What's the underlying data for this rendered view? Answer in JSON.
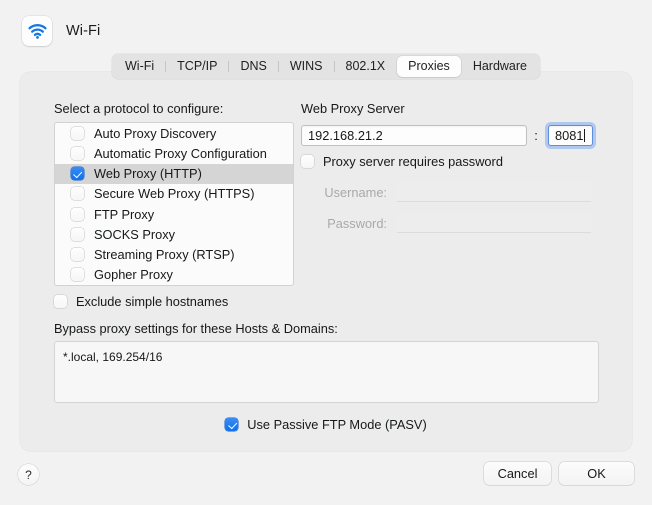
{
  "window": {
    "title": "Wi-Fi",
    "icon": "wifi-icon",
    "accent_color": "#1070ea",
    "background_color": "#f2f2f2",
    "card_color": "#ececec"
  },
  "tabs": [
    {
      "label": "Wi-Fi",
      "selected": false
    },
    {
      "label": "TCP/IP",
      "selected": false
    },
    {
      "label": "DNS",
      "selected": false
    },
    {
      "label": "WINS",
      "selected": false
    },
    {
      "label": "802.1X",
      "selected": false
    },
    {
      "label": "Proxies",
      "selected": true
    },
    {
      "label": "Hardware",
      "selected": false
    }
  ],
  "protocols": {
    "title": "Select a protocol to configure:",
    "items": [
      {
        "label": "Auto Proxy Discovery",
        "checked": false,
        "selected": false
      },
      {
        "label": "Automatic Proxy Configuration",
        "checked": false,
        "selected": false
      },
      {
        "label": "Web Proxy (HTTP)",
        "checked": true,
        "selected": true
      },
      {
        "label": "Secure Web Proxy (HTTPS)",
        "checked": false,
        "selected": false
      },
      {
        "label": "FTP Proxy",
        "checked": false,
        "selected": false
      },
      {
        "label": "SOCKS Proxy",
        "checked": false,
        "selected": false
      },
      {
        "label": "Streaming Proxy (RTSP)",
        "checked": false,
        "selected": false
      },
      {
        "label": "Gopher Proxy",
        "checked": false,
        "selected": false
      }
    ]
  },
  "server": {
    "title": "Web Proxy Server",
    "host_value": "192.168.21.2",
    "host_placeholder": "",
    "separator": ":",
    "port_value": "8081",
    "port_placeholder": "",
    "port_focused": true,
    "focus_ring_color": "#5b8fdd",
    "requires_password_label": "Proxy server requires password",
    "requires_password_checked": false,
    "username_label": "Username:",
    "username_value": "",
    "password_label": "Password:",
    "password_value": "",
    "credentials_enabled": false
  },
  "options": {
    "exclude_simple_hostnames_label": "Exclude simple hostnames",
    "exclude_simple_hostnames_checked": false,
    "bypass_title": "Bypass proxy settings for these Hosts & Domains:",
    "bypass_value": "*.local, 169.254/16",
    "passive_ftp_label": "Use Passive FTP Mode (PASV)",
    "passive_ftp_checked": true
  },
  "footer": {
    "help_label": "?",
    "cancel_label": "Cancel",
    "ok_label": "OK"
  }
}
